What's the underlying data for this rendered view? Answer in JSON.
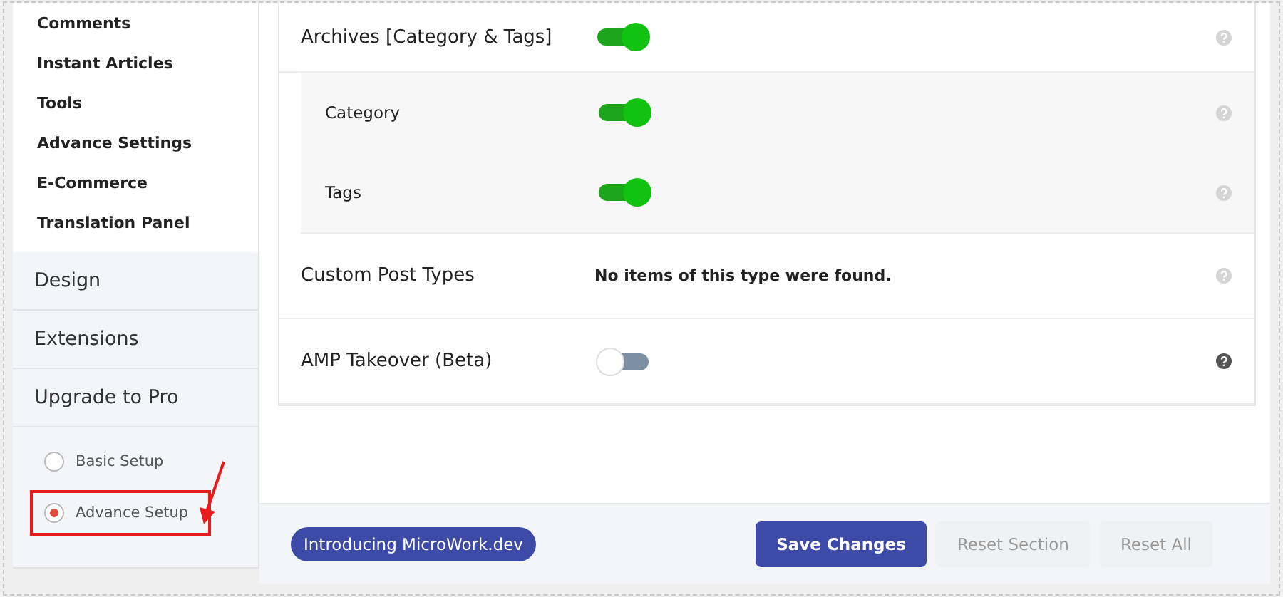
{
  "sidebar": {
    "subitems": [
      "Comments",
      "Instant Articles",
      "Tools",
      "Advance Settings",
      "E-Commerce",
      "Translation Panel"
    ],
    "sections": [
      "Design",
      "Extensions",
      "Upgrade to Pro"
    ],
    "setup_options": [
      {
        "label": "Basic Setup",
        "selected": false,
        "highlighted": false
      },
      {
        "label": "Advance Setup",
        "selected": true,
        "highlighted": true
      }
    ]
  },
  "settings": [
    {
      "label": "Archives [Category & Tags]",
      "kind": "toggle",
      "on": true,
      "children": [
        {
          "label": "Category",
          "on": true
        },
        {
          "label": "Tags",
          "on": true
        }
      ]
    },
    {
      "label": "Custom Post Types",
      "kind": "text",
      "value": "No items of this type were found."
    },
    {
      "label": "AMP Takeover (Beta)",
      "kind": "toggle",
      "on": false
    }
  ],
  "footer": {
    "badge": "Introducing MicroWork.dev",
    "buttons": [
      {
        "label": "Save Changes",
        "kind": "primary"
      },
      {
        "label": "Reset Section",
        "kind": "secondary"
      },
      {
        "label": "Reset All",
        "kind": "secondary"
      }
    ]
  }
}
